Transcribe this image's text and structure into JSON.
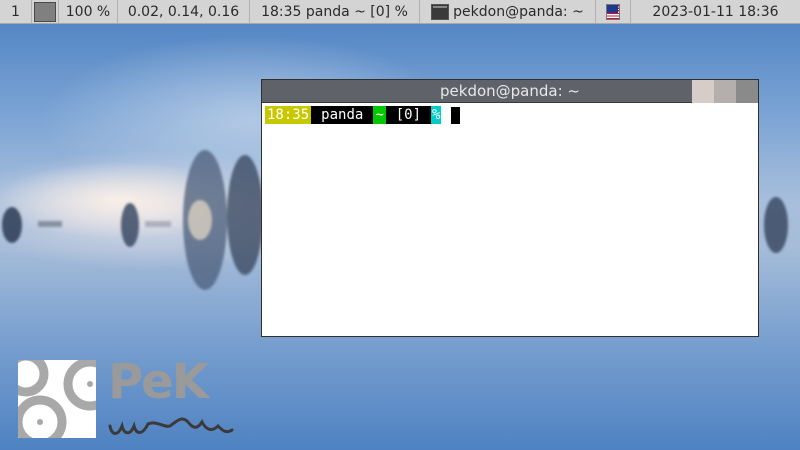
{
  "topbar": {
    "workspace": "1",
    "cpu": "100 %",
    "load": "0.02, 0.14, 0.16",
    "status": "18:35 panda ~ [0] %",
    "window_title": "pekdon@panda: ~",
    "clock": "2023-01-11 18:36",
    "keyboard_layout_icon": "us-flag-icon"
  },
  "terminal": {
    "title": "pekdon@panda: ~",
    "prompt": {
      "time": "18:35",
      "host": "panda",
      "dir": "~",
      "jobs": "[0]",
      "symbol": "%"
    }
  },
  "logo": {
    "text": "PeK",
    "subtitle_icon": "wm-signature-icon"
  },
  "colors": {
    "panel_bg": "#d4d4d4",
    "titlebar_bg": "#5f6369",
    "prompt_time_bg": "#c8c800",
    "prompt_dir_bg": "#00c800",
    "prompt_symbol_bg": "#00cccc"
  }
}
